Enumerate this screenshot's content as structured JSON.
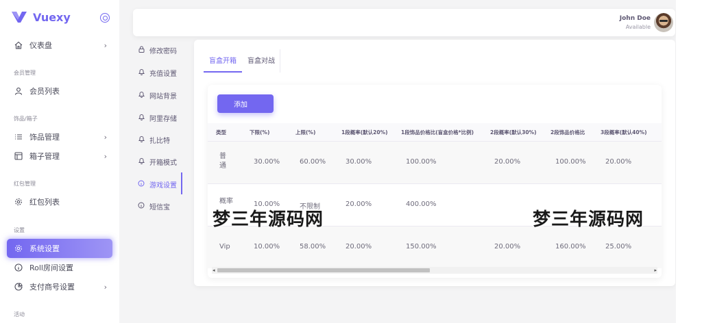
{
  "brand": {
    "name": "Vuexy",
    "color": "#7367f0"
  },
  "sidebar": {
    "items": [
      {
        "label": "仪表盘",
        "icon": "home-icon",
        "chevron": "›"
      },
      {
        "label": "会员列表",
        "icon": "user-icon"
      },
      {
        "label": "饰品管理",
        "icon": "list-icon",
        "chevron": "›"
      },
      {
        "label": "箱子管理",
        "icon": "layout-icon",
        "chevron": "›"
      },
      {
        "label": "红包列表",
        "icon": "gear-icon"
      },
      {
        "label": "系统设置",
        "icon": "gear-icon",
        "active": true
      },
      {
        "label": "Roll房间设置",
        "icon": "info-icon"
      },
      {
        "label": "支付商号设置",
        "icon": "pie-icon",
        "chevron": "›"
      }
    ],
    "sections": [
      "会员管理",
      "饰品/箱子",
      "红包管理",
      "设置",
      "活动"
    ]
  },
  "navbar": {
    "user_name": "John Doe",
    "user_status": "Available"
  },
  "submenu": {
    "items": [
      {
        "label": "修改密码",
        "icon": "lock-icon"
      },
      {
        "label": "充值设置",
        "icon": "bell-icon"
      },
      {
        "label": "网站背景",
        "icon": "bell-icon"
      },
      {
        "label": "阿里存储",
        "icon": "bell-icon"
      },
      {
        "label": "扎比特",
        "icon": "bell-icon"
      },
      {
        "label": "开箱模式",
        "icon": "bell-icon"
      },
      {
        "label": "游戏设置",
        "icon": "info-icon",
        "active": true
      },
      {
        "label": "短信宝",
        "icon": "info-icon"
      }
    ]
  },
  "tabs": [
    {
      "label": "盲盒开箱",
      "active": true
    },
    {
      "label": "盲盒对战"
    }
  ],
  "add_button": "添加",
  "table": {
    "headers": [
      "类型",
      "下限(%)",
      "上限(%)",
      "1段概率(默认20%)",
      "1段饰品价格比(盲盒价格*比例)",
      "2段概率(默认30%)",
      "2段饰品价格比",
      "3段概率(默认40%)"
    ],
    "rows": [
      [
        "普通",
        "30.00%",
        "60.00%",
        "30.00%",
        "100.00%",
        "20.00%",
        "100.00%",
        "20.00%"
      ],
      [
        "概率",
        "10.00%",
        "不限制",
        "20.00%",
        "400.00%",
        "",
        "",
        ""
      ],
      [
        "Vip",
        "10.00%",
        "58.00%",
        "20.00%",
        "150.00%",
        "20.00%",
        "160.00%",
        "25.00%"
      ]
    ]
  },
  "watermark": "梦三年源码网",
  "scroll": {
    "left_arrow": "◂",
    "right_arrow": "▸"
  }
}
